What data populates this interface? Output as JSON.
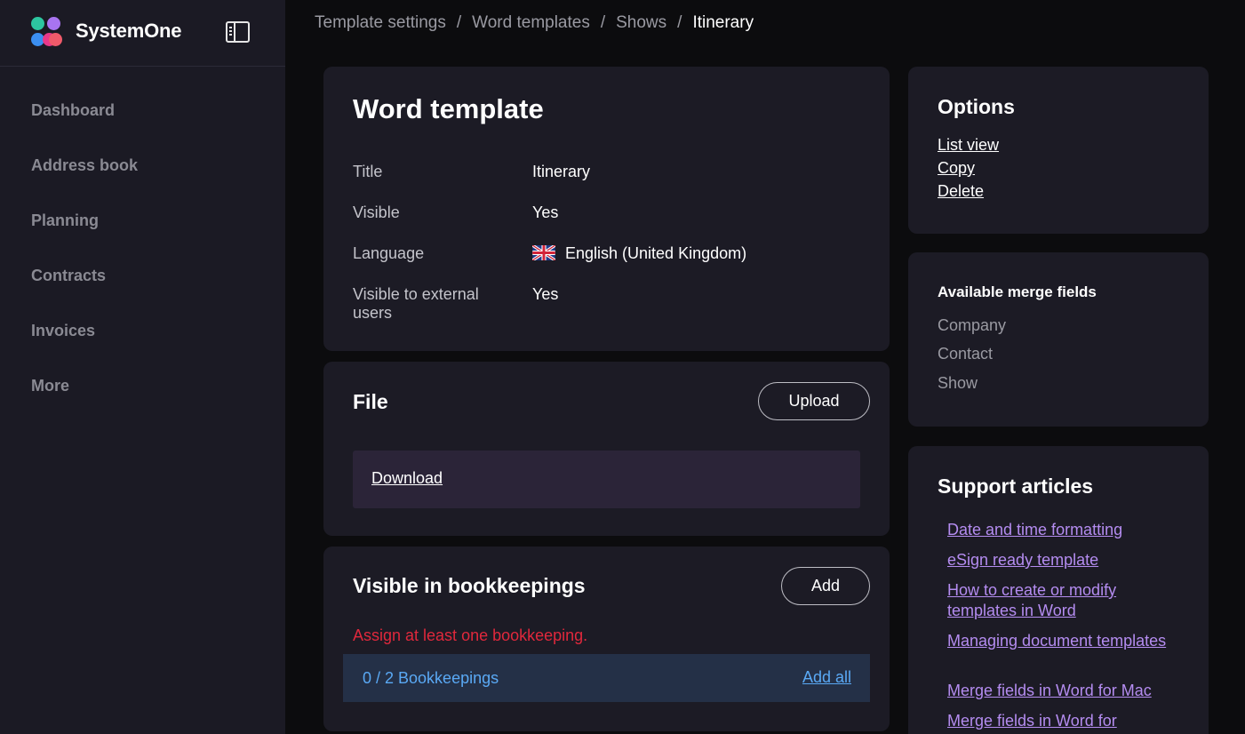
{
  "brand": {
    "name": "SystemOne",
    "logo_colors": [
      "#2dc6a0",
      "#a874f0",
      "#3b8ef0",
      "#e8388a",
      "#f05a6a"
    ]
  },
  "sidebar": {
    "toggle_icon": "sidebar-toggle-icon",
    "items": [
      {
        "label": "Dashboard"
      },
      {
        "label": "Address book"
      },
      {
        "label": "Planning"
      },
      {
        "label": "Contracts"
      },
      {
        "label": "Invoices"
      },
      {
        "label": "More"
      }
    ]
  },
  "breadcrumb": {
    "separator": "/",
    "items": [
      "Template settings",
      "Word templates",
      "Shows"
    ],
    "current": "Itinerary"
  },
  "word_template": {
    "title": "Word template",
    "fields": [
      {
        "label": "Title",
        "value": "Itinerary"
      },
      {
        "label": "Visible",
        "value": "Yes"
      },
      {
        "label": "Language",
        "value": "English (United Kingdom)",
        "icon": "uk-flag-icon"
      },
      {
        "label": "Visible to external users",
        "value": "Yes"
      }
    ]
  },
  "file": {
    "title": "File",
    "upload_label": "Upload",
    "download_label": "Download"
  },
  "bookkeepings": {
    "title": "Visible in bookkeepings",
    "add_label": "Add",
    "warning": "Assign at least one bookkeeping.",
    "count_text": "0 / 2 Bookkeepings",
    "add_all_label": "Add all"
  },
  "options": {
    "title": "Options",
    "links": [
      "List view",
      "Copy",
      "Delete"
    ]
  },
  "merge_fields": {
    "title": "Available merge fields",
    "items": [
      "Company",
      "Contact",
      "Show"
    ]
  },
  "support": {
    "title": "Support articles",
    "links": [
      "Date and time formatting",
      "eSign ready template",
      "How to create or modify templates in Word",
      "Managing document templates",
      "Merge fields in Word for Mac",
      "Merge fields in Word for"
    ]
  },
  "colors": {
    "background": "#0c0c0e",
    "card": "#1c1b25",
    "sidebar": "#1b1a24",
    "link_purple": "#b48cf0",
    "link_blue": "#5aa9f5",
    "warning_red": "#e0283c"
  }
}
